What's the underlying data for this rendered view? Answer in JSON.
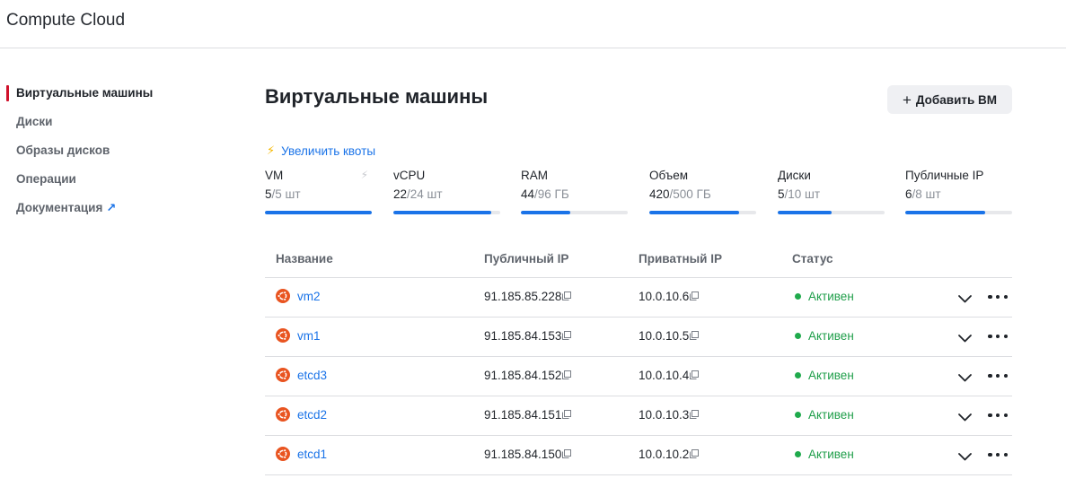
{
  "app": {
    "title": "Compute Cloud"
  },
  "sidebar": {
    "items": [
      {
        "label": "Виртуальные машины",
        "active": true
      },
      {
        "label": "Диски",
        "active": false
      },
      {
        "label": "Образы дисков",
        "active": false
      },
      {
        "label": "Операции",
        "active": false
      },
      {
        "label": "Документация",
        "active": false,
        "external": true,
        "icon": "external-link-icon"
      }
    ]
  },
  "page": {
    "title": "Виртуальные машины",
    "add_button": {
      "label": "Добавить ВМ",
      "icon": "plus-icon"
    },
    "quota_link": {
      "label": "Увеличить квоты",
      "icon": "lightning-icon"
    }
  },
  "quotas": [
    {
      "label": "VM",
      "used": "5",
      "limit": "/5 шт",
      "fraction": 1.0,
      "warning": true
    },
    {
      "label": "vCPU",
      "used": "22",
      "limit": "/24 шт",
      "fraction": 0.917,
      "warning": false
    },
    {
      "label": "RAM",
      "used": "44",
      "limit": "/96 ГБ",
      "fraction": 0.458,
      "warning": false
    },
    {
      "label": "Объем",
      "used": "420",
      "limit": "/500 ГБ",
      "fraction": 0.84,
      "warning": false
    },
    {
      "label": "Диски",
      "used": "5",
      "limit": "/10 шт",
      "fraction": 0.5,
      "warning": false
    },
    {
      "label": "Публичные IP",
      "used": "6",
      "limit": "/8 шт",
      "fraction": 0.75,
      "warning": false
    }
  ],
  "table": {
    "columns": [
      "Название",
      "Публичный IP",
      "Приватный IP",
      "Статус"
    ],
    "rows": [
      {
        "name": "vm2",
        "public_ip": "91.185.85.228",
        "private_ip": "10.0.10.6",
        "status": "Активен"
      },
      {
        "name": "vm1",
        "public_ip": "91.185.84.153",
        "private_ip": "10.0.10.5",
        "status": "Активен"
      },
      {
        "name": "etcd3",
        "public_ip": "91.185.84.152",
        "private_ip": "10.0.10.4",
        "status": "Активен"
      },
      {
        "name": "etcd2",
        "public_ip": "91.185.84.151",
        "private_ip": "10.0.10.3",
        "status": "Активен"
      },
      {
        "name": "etcd1",
        "public_ip": "91.185.84.150",
        "private_ip": "10.0.10.2",
        "status": "Активен"
      }
    ]
  },
  "colors": {
    "accent": "#1a73e8",
    "active_marker": "#d0112b",
    "status_ok": "#1faa4c",
    "ubuntu": "#e95420"
  }
}
